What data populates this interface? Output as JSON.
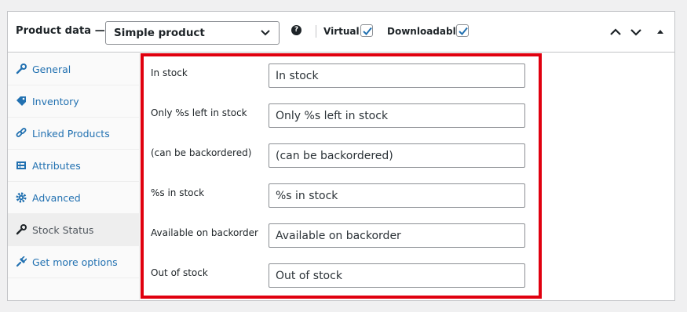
{
  "header": {
    "title": "Product data —",
    "product_type": "Simple product",
    "virtual_label": "Virtual:",
    "virtual_checked": true,
    "downloadable_label": "Downloadable:",
    "downloadable_checked": true
  },
  "sidebar": {
    "items": [
      {
        "label": "General",
        "icon": "wrench-icon",
        "active": false
      },
      {
        "label": "Inventory",
        "icon": "tag-icon",
        "active": false
      },
      {
        "label": "Linked Products",
        "icon": "link-icon",
        "active": false
      },
      {
        "label": "Attributes",
        "icon": "table-icon",
        "active": false
      },
      {
        "label": "Advanced",
        "icon": "gear-icon",
        "active": false
      },
      {
        "label": "Stock Status",
        "icon": "wrench-icon",
        "active": true
      },
      {
        "label": "Get more options",
        "icon": "plugin-icon",
        "active": false
      }
    ]
  },
  "stock_fields": [
    {
      "label": "In stock",
      "value": "In stock"
    },
    {
      "label": "Only %s left in stock",
      "value": "Only %s left in stock"
    },
    {
      "label": "(can be backordered)",
      "value": "(can be backordered)"
    },
    {
      "label": "%s in stock",
      "value": "%s in stock"
    },
    {
      "label": "Available on backorder",
      "value": "Available on backorder"
    },
    {
      "label": "Out of stock",
      "value": "Out of stock"
    }
  ],
  "colors": {
    "highlight": "#e0000f",
    "link": "#2271b1",
    "checkbox_check": "#2271b1"
  }
}
